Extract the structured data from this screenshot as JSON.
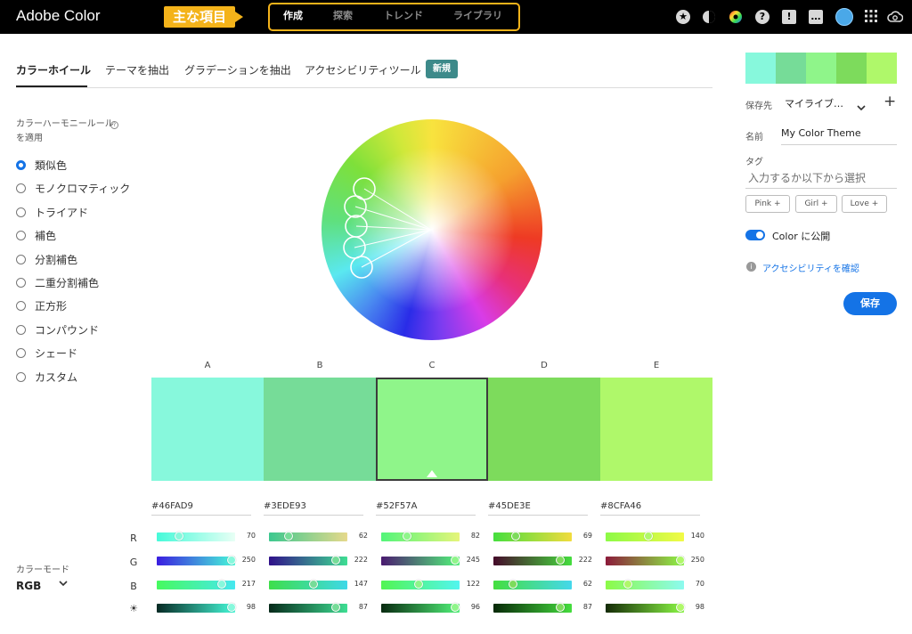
{
  "topbar": {
    "brand": "Adobe Color",
    "annotation": "主な項目",
    "nav": [
      {
        "label": "作成",
        "active": true
      },
      {
        "label": "探索",
        "active": false
      },
      {
        "label": "トレンド",
        "active": false
      },
      {
        "label": "ライブラリ",
        "active": false
      }
    ],
    "icons": [
      "star-icon",
      "contrast-icon",
      "color-wheel-icon",
      "help-icon",
      "alert-icon",
      "chat-icon",
      "avatar",
      "apps-grid-icon",
      "creative-cloud-icon"
    ]
  },
  "tabs": {
    "items": [
      "カラーホイール",
      "テーマを抽出",
      "グラデーションを抽出",
      "アクセシビリティツール"
    ],
    "badge": "新規"
  },
  "harmony": {
    "title": "カラーハーモニールールを適用",
    "options": [
      "類似色",
      "モノクロマティック",
      "トライアド",
      "補色",
      "分割補色",
      "二重分割補色",
      "正方形",
      "コンパウンド",
      "シェード",
      "カスタム"
    ],
    "selected": 0
  },
  "color_mode": {
    "label": "カラーモード",
    "value": "RGB"
  },
  "swatches": [
    {
      "label": "A",
      "hex": "#46FAD9",
      "color": "#87f8dc",
      "values": [
        70,
        250,
        217,
        98
      ]
    },
    {
      "label": "B",
      "hex": "#3EDE93",
      "color": "#76dc98",
      "values": [
        62,
        222,
        147,
        87
      ]
    },
    {
      "label": "C",
      "hex": "#52F57A",
      "color": "#8ff58a",
      "values": [
        82,
        245,
        122,
        96
      ],
      "selected": true
    },
    {
      "label": "D",
      "hex": "#45DE3E",
      "color": "#7ddb5c",
      "values": [
        69,
        222,
        62,
        87
      ]
    },
    {
      "label": "E",
      "hex": "#8CFA46",
      "color": "#aff86a",
      "values": [
        140,
        250,
        70,
        98
      ]
    }
  ],
  "slider_rows": [
    "R",
    "G",
    "B",
    "☀"
  ],
  "right_panel": {
    "save_to_label": "保存先",
    "save_to_value": "マイライブ…",
    "name_label": "名前",
    "name_value": "My Color Theme",
    "tag_label": "タグ",
    "tag_placeholder": "入力するか以下から選択",
    "chips": [
      "Pink +",
      "Girl +",
      "Love +"
    ],
    "publish_label": "Color に公開",
    "publish_on": true,
    "a11y_link": "アクセシビリティを確認",
    "save_button": "保存"
  }
}
